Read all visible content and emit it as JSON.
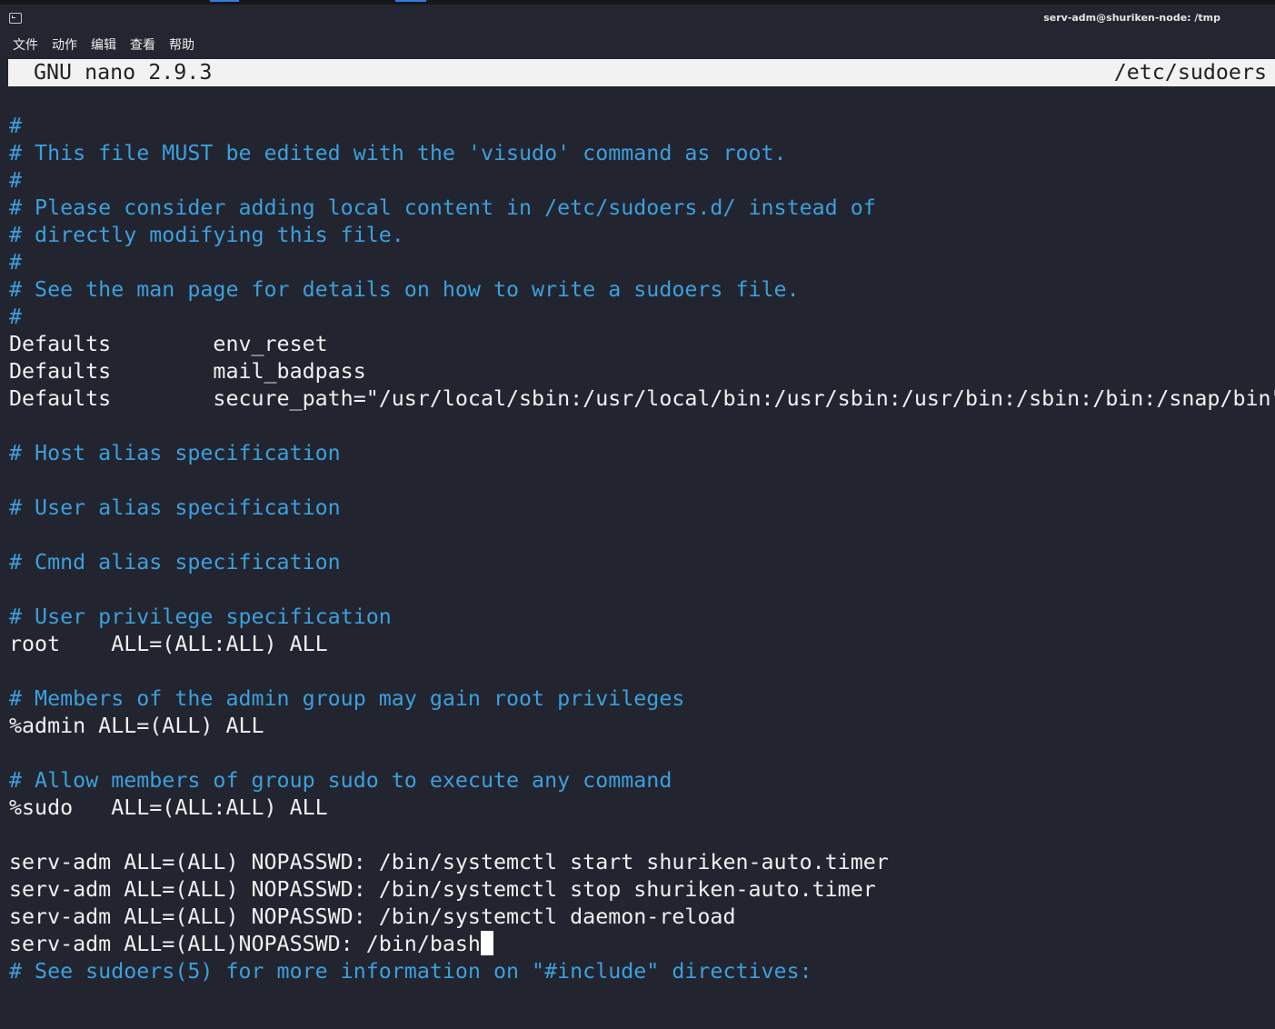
{
  "window": {
    "title": "serv-adm@shuriken-node: /tmp",
    "menu": [
      "文件",
      "动作",
      "编辑",
      "查看",
      "帮助"
    ]
  },
  "nano": {
    "version": "GNU nano 2.9.3",
    "filename": "/etc/sudoers"
  },
  "colors": {
    "background": "#222530",
    "comment": "#3d9fdb",
    "text": "#f0f0f0"
  },
  "lines": [
    {
      "text": "#",
      "type": "comment"
    },
    {
      "text": "# This file MUST be edited with the 'visudo' command as root.",
      "type": "comment"
    },
    {
      "text": "#",
      "type": "comment"
    },
    {
      "text": "# Please consider adding local content in /etc/sudoers.d/ instead of",
      "type": "comment"
    },
    {
      "text": "# directly modifying this file.",
      "type": "comment"
    },
    {
      "text": "#",
      "type": "comment"
    },
    {
      "text": "# See the man page for details on how to write a sudoers file.",
      "type": "comment"
    },
    {
      "text": "#",
      "type": "comment"
    },
    {
      "text": "Defaults        env_reset",
      "type": "code"
    },
    {
      "text": "Defaults        mail_badpass",
      "type": "code"
    },
    {
      "text": "Defaults        secure_path=\"/usr/local/sbin:/usr/local/bin:/usr/sbin:/usr/bin:/sbin:/bin:/snap/bin\"",
      "type": "code"
    },
    {
      "text": "",
      "type": "code"
    },
    {
      "text": "# Host alias specification",
      "type": "comment"
    },
    {
      "text": "",
      "type": "code"
    },
    {
      "text": "# User alias specification",
      "type": "comment"
    },
    {
      "text": "",
      "type": "code"
    },
    {
      "text": "# Cmnd alias specification",
      "type": "comment"
    },
    {
      "text": "",
      "type": "code"
    },
    {
      "text": "# User privilege specification",
      "type": "comment"
    },
    {
      "text": "root    ALL=(ALL:ALL) ALL",
      "type": "code"
    },
    {
      "text": "",
      "type": "code"
    },
    {
      "text": "# Members of the admin group may gain root privileges",
      "type": "comment"
    },
    {
      "text": "%admin ALL=(ALL) ALL",
      "type": "code"
    },
    {
      "text": "",
      "type": "code"
    },
    {
      "text": "# Allow members of group sudo to execute any command",
      "type": "comment"
    },
    {
      "text": "%sudo   ALL=(ALL:ALL) ALL",
      "type": "code"
    },
    {
      "text": "",
      "type": "code"
    },
    {
      "text": "serv-adm ALL=(ALL) NOPASSWD: /bin/systemctl start shuriken-auto.timer",
      "type": "code"
    },
    {
      "text": "serv-adm ALL=(ALL) NOPASSWD: /bin/systemctl stop shuriken-auto.timer",
      "type": "code"
    },
    {
      "text": "serv-adm ALL=(ALL) NOPASSWD: /bin/systemctl daemon-reload",
      "type": "code"
    },
    {
      "text": "serv-adm ALL=(ALL)NOPASSWD: /bin/bash",
      "type": "code",
      "cursor": true
    },
    {
      "text": "# See sudoers(5) for more information on \"#include\" directives:",
      "type": "comment"
    }
  ]
}
